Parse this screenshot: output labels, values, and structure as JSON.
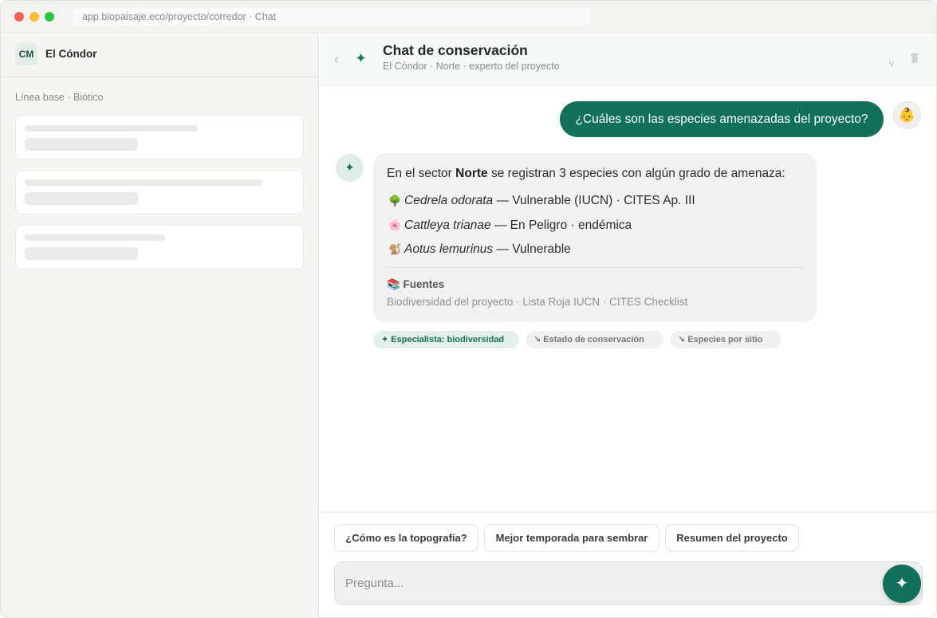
{
  "browser": {
    "url": "app.biopaisaje.eco/proyecto/corredor · Chat"
  },
  "sidebar": {
    "logo_initials": "CM",
    "project_name": "El Cóndor",
    "section_label": "Línea base · Biótico"
  },
  "chat": {
    "title": "Chat de conservación",
    "subtitle": "El Cóndor · Norte · experto del proyecto",
    "user_message": "¿Cuáles son las especies amenazadas del proyecto?",
    "bot": {
      "intro_pre": "En el sector ",
      "intro_bold": "Norte",
      "intro_post": " se registran 3 especies con algún grado de amenaza:",
      "species": [
        {
          "icon": "🌳",
          "name": "Cedrela odorata",
          "status": " — Vulnerable (IUCN) · CITES Ap. III"
        },
        {
          "icon": "🌸",
          "name": "Cattleya trianae",
          "status": " — En Peligro · endémica"
        },
        {
          "icon": "🐒",
          "name": "Aotus lemurinus",
          "status": " — Vulnerable"
        }
      ],
      "sources_title": "📚 Fuentes",
      "sources": "Biodiversidad del proyecto · Lista Roja IUCN · CITES Checklist"
    },
    "chips": [
      {
        "label": "✦ Especialista: biodiversidad"
      },
      {
        "label": "↘ Estado de conservación"
      },
      {
        "label": "↘ Especies por sitio"
      }
    ]
  },
  "composer": {
    "suggestions": [
      "¿Cómo es la topografía?",
      "Mejor temporada para sembrar",
      "Resumen del proyecto"
    ],
    "placeholder": "Pregunta..."
  },
  "colors": {
    "accent": "#11705a",
    "accent_light": "#e3f0ea"
  },
  "icons": {
    "header": "sparkle-icon",
    "send": "sparkle-icon",
    "back": "chevron-left-icon",
    "menu": "chevron-down-icon",
    "delete": "trash-icon"
  }
}
